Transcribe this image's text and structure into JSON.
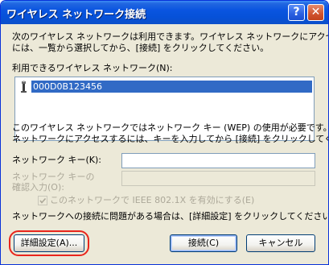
{
  "window": {
    "title": "ワイヤレス ネットワーク接続",
    "help_glyph": "?",
    "close_glyph": "✕"
  },
  "intro": {
    "line1": "次のワイヤレス ネットワークは利用できます。ワイヤレス ネットワークにアクセスする",
    "line2": "には、一覧から選択してから、[接続] をクリックしてください。"
  },
  "network_list": {
    "label": "利用できるワイヤレス ネットワーク(N):",
    "items": [
      {
        "name": "000D0B123456",
        "icon": "wireless-network-icon",
        "selected": true
      }
    ]
  },
  "wep_notice": {
    "line1": "このワイヤレス ネットワークではネットワーク キー (WEP) の使用が必要です。この",
    "line2": "ネットワークにアクセスするには、キーを入力してから [接続] をクリックしてください。"
  },
  "key_field": {
    "label": "ネットワーク キー(K):",
    "value": ""
  },
  "confirm_field": {
    "label_line1": "ネットワーク キーの",
    "label_line2": "確認入力(O):",
    "value": ""
  },
  "ieee_checkbox": {
    "label": "このネットワークで IEEE 802.1X を有効にする(E)",
    "checked": true,
    "enabled": false
  },
  "help_text": "ネットワークへの接続に問題がある場合は、[詳細設定] をクリックしてください。",
  "buttons": {
    "advanced": "詳細設定(A)...",
    "connect": "接続(C)",
    "cancel": "キャンセル"
  },
  "colors": {
    "titlebar": "#0a55e0",
    "selection": "#316ac5",
    "highlight_ring": "#e8251c",
    "dialog_bg": "#ece9d8"
  }
}
